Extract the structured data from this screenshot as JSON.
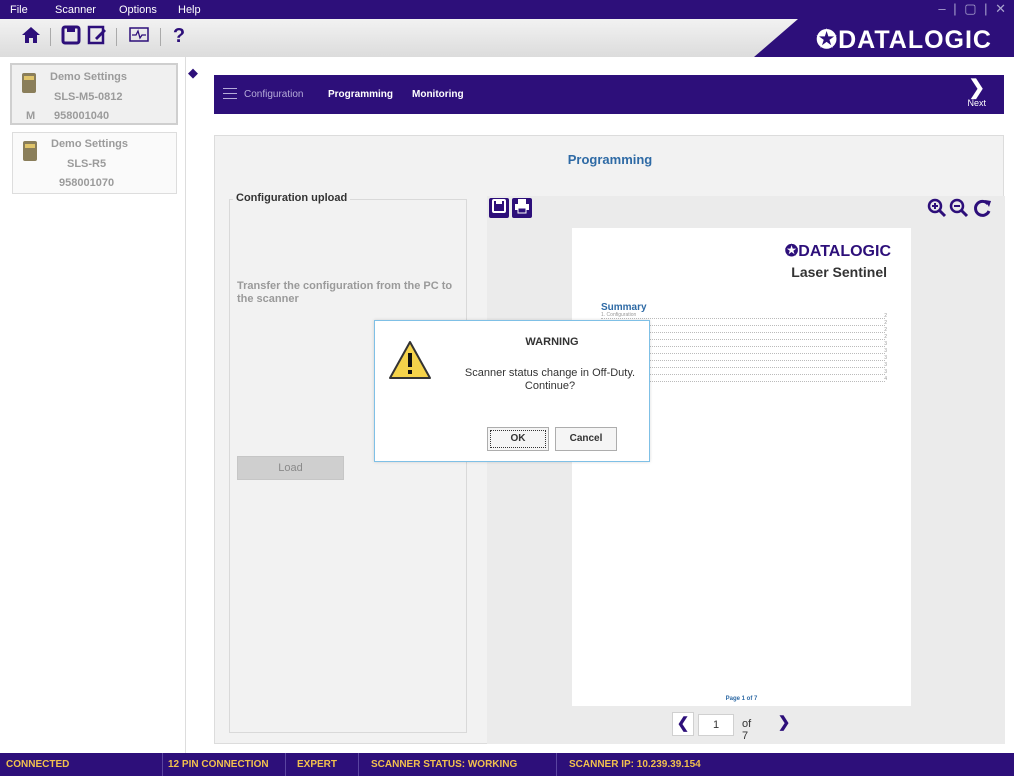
{
  "menu": {
    "file": "File",
    "scanner": "Scanner",
    "options": "Options",
    "help": "Help"
  },
  "window_controls": "– | ▢ | ✕",
  "toolbar_icons": [
    "home-icon",
    "save-icon",
    "edit-document-icon",
    "monitor-icon",
    "help-icon"
  ],
  "help_label": "?",
  "brand": {
    "logo": "✪DATALOGIC",
    "color": "#2d0f7a"
  },
  "devices": [
    {
      "name": "Demo Settings",
      "model": "SLS-M5-0812",
      "badge": "M",
      "serial": "958001040",
      "selected": true
    },
    {
      "name": "Demo Settings",
      "model": "SLS-R5",
      "badge": "",
      "serial": "958001070",
      "selected": false
    }
  ],
  "nav": {
    "configuration": "Configuration",
    "programming": "Programming",
    "monitoring": "Monitoring",
    "next": "Next"
  },
  "page": {
    "title": "Programming"
  },
  "upload": {
    "title": "Configuration upload",
    "description": "Transfer the configuration from the PC to the scanner",
    "load": "Load"
  },
  "preview": {
    "logo": "✪DATALOGIC",
    "product": "Laser Sentinel",
    "summary": "Summary",
    "first_entry": "1. Configuration",
    "entry_pages": [
      "2",
      "2",
      "2",
      "2",
      "3",
      "3",
      "3",
      "3",
      "3",
      "4"
    ],
    "footer": "Page 1 of 7"
  },
  "pager": {
    "current": "1",
    "of": "of 7"
  },
  "dialog": {
    "title": "WARNING",
    "message": "Scanner status change in Off-Duty. Continue?",
    "ok": "OK",
    "cancel": "Cancel"
  },
  "status": {
    "connection": "CONNECTED",
    "pins": "12 PIN CONNECTION",
    "mode": "EXPERT",
    "scanner_status": "SCANNER STATUS: WORKING",
    "ip": "SCANNER IP: 10.239.39.154"
  }
}
